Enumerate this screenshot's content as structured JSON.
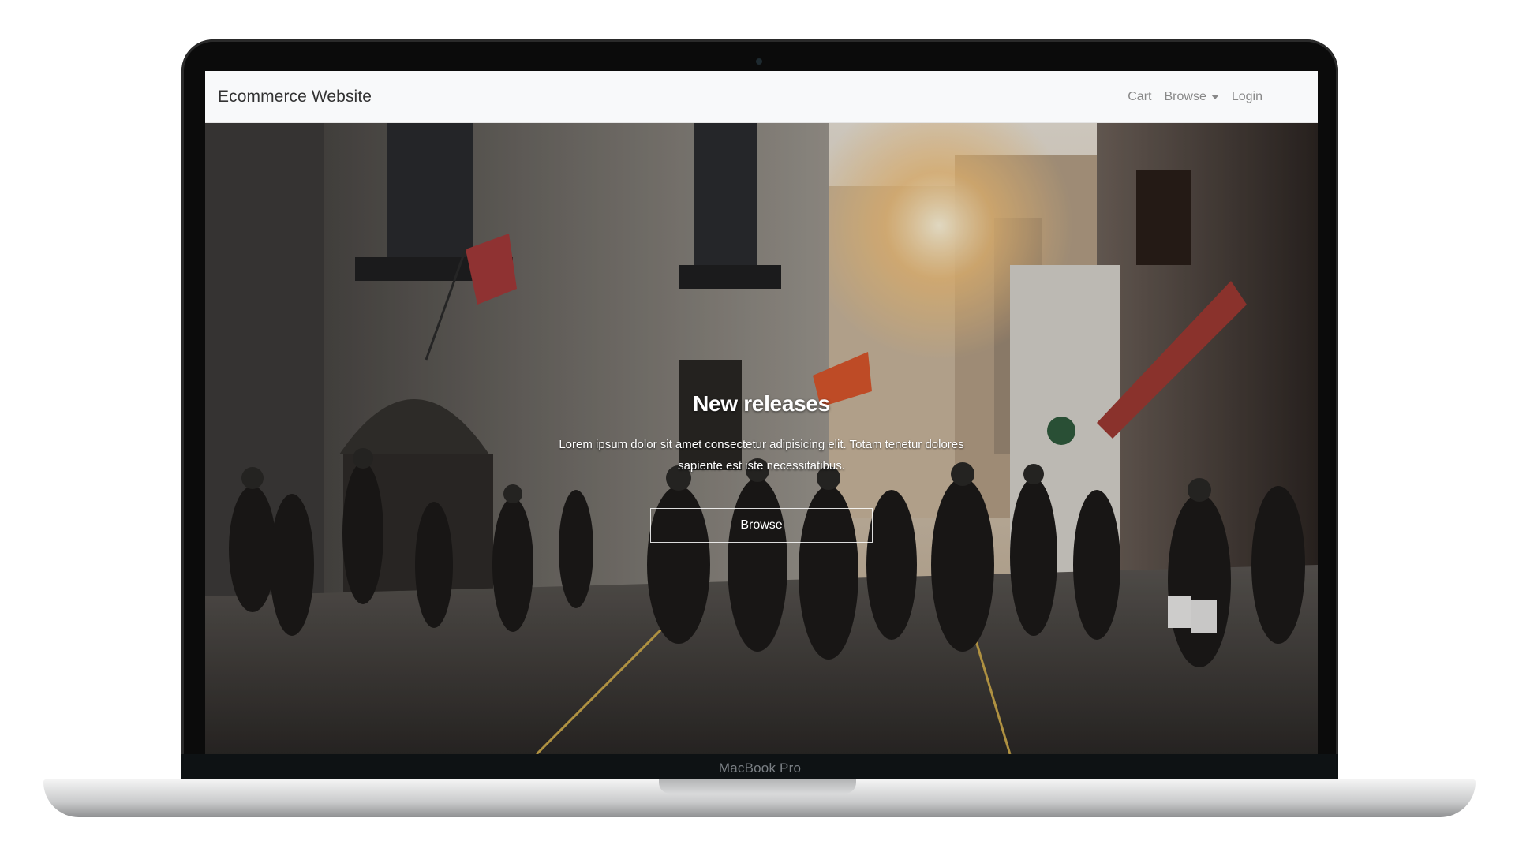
{
  "device": {
    "model_label": "MacBook Pro"
  },
  "navbar": {
    "brand": "Ecommerce Website",
    "links": {
      "cart": "Cart",
      "browse": "Browse",
      "login": "Login"
    }
  },
  "hero": {
    "title": "New releases",
    "text": "Lorem ipsum dolor sit amet consectetur adipisicing elit. Totam tenetur dolores sapiente est iste necessitatibus.",
    "button_label": "Browse"
  },
  "colors": {
    "navbar_bg": "#f8f9fa",
    "nav_link": "#888888",
    "brand_text": "#333333",
    "hero_text": "#ffffff"
  },
  "icons": {
    "browse_dropdown": "caret-down-icon"
  }
}
